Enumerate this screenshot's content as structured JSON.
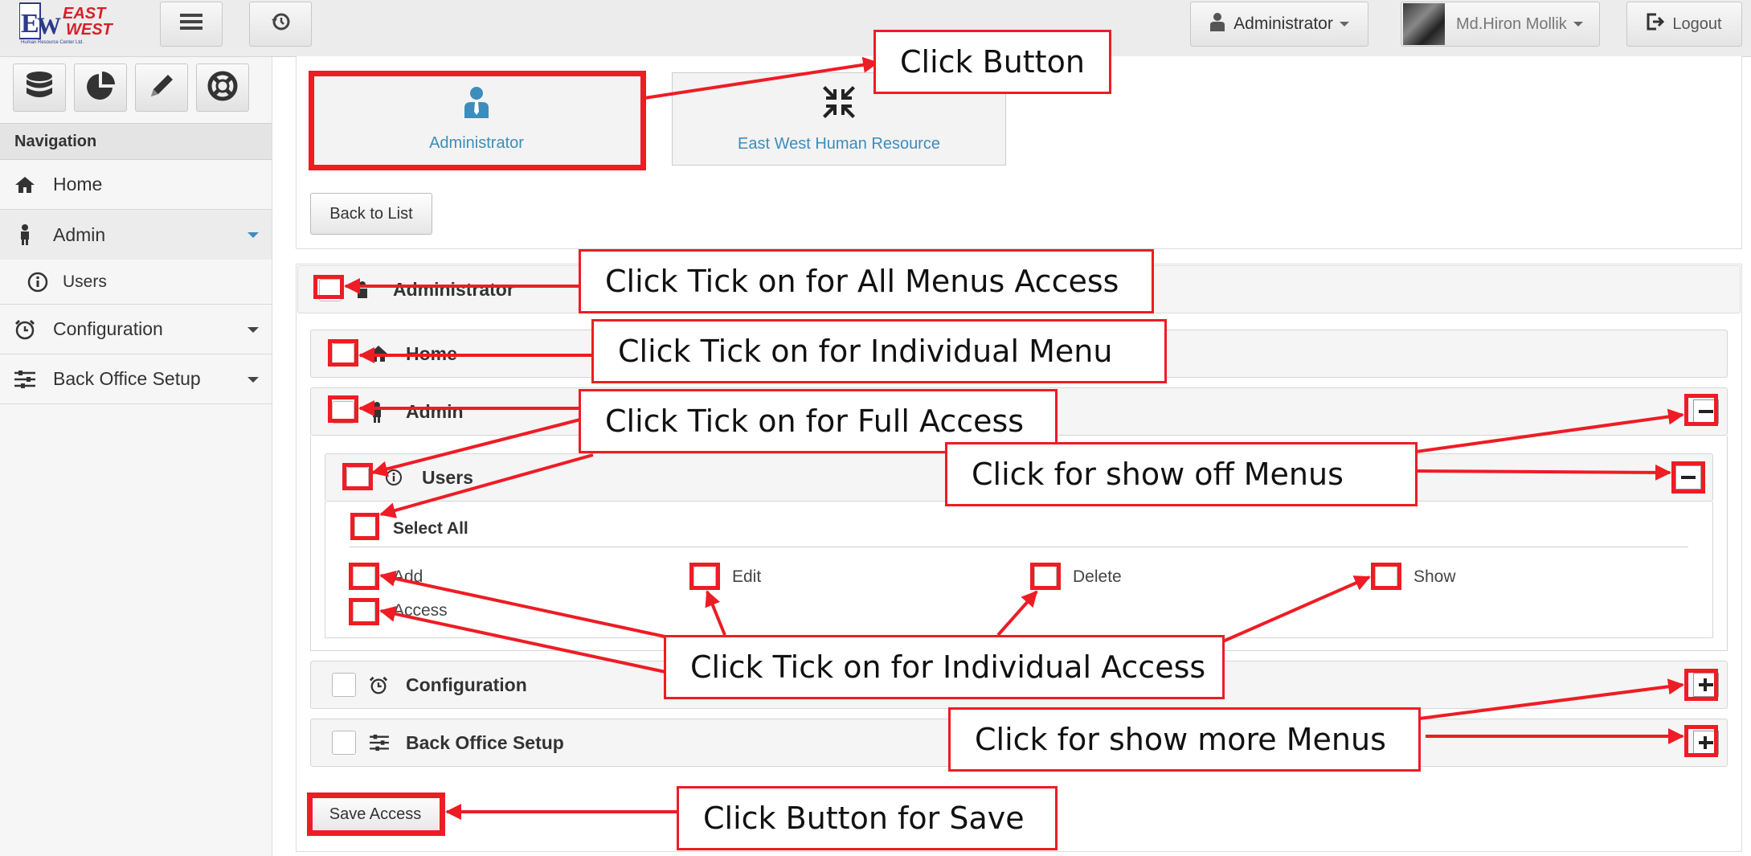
{
  "header": {
    "logo_text_top": "EAST",
    "logo_text_bottom": "WEST",
    "logo_caption": "Human Resource Center Ltd.",
    "role_dropdown": "Administrator",
    "user_name": "Md.Hiron Mollik",
    "logout_label": "Logout"
  },
  "sidebar": {
    "nav_heading": "Navigation",
    "items": [
      {
        "label": "Home",
        "icon": "home-icon"
      },
      {
        "label": "Admin",
        "icon": "user-icon"
      },
      {
        "label": "Users",
        "icon": "info-icon"
      },
      {
        "label": "Configuration",
        "icon": "clock-icon"
      },
      {
        "label": "Back Office Setup",
        "icon": "sliders-icon"
      }
    ]
  },
  "main": {
    "cards": [
      "Administrator",
      "East West Human Resource"
    ],
    "back_button": "Back to List",
    "role_title": "Administrator",
    "modules": {
      "home": "Home",
      "admin": "Admin",
      "users": "Users",
      "configuration": "Configuration",
      "back_office": "Back Office Setup"
    },
    "select_all": "Select All",
    "permissions": [
      "Add",
      "Edit",
      "Delete",
      "Show",
      "Access"
    ],
    "save_button": "Save Access"
  },
  "annotations": {
    "click_button": "Click Button",
    "all_menus": "Click Tick on for All Menus Access",
    "individual_menu": "Click Tick on for Individual Menu",
    "full_access": "Click Tick on for Full Access",
    "show_off": "Click for show off Menus",
    "individual_access": "Click Tick on for Individual Access",
    "show_more": "Click for show more Menus",
    "save": "Click Button for Save"
  },
  "colors": {
    "annotation_red": "#ee1c25",
    "accent_blue": "#3c8dbc"
  }
}
